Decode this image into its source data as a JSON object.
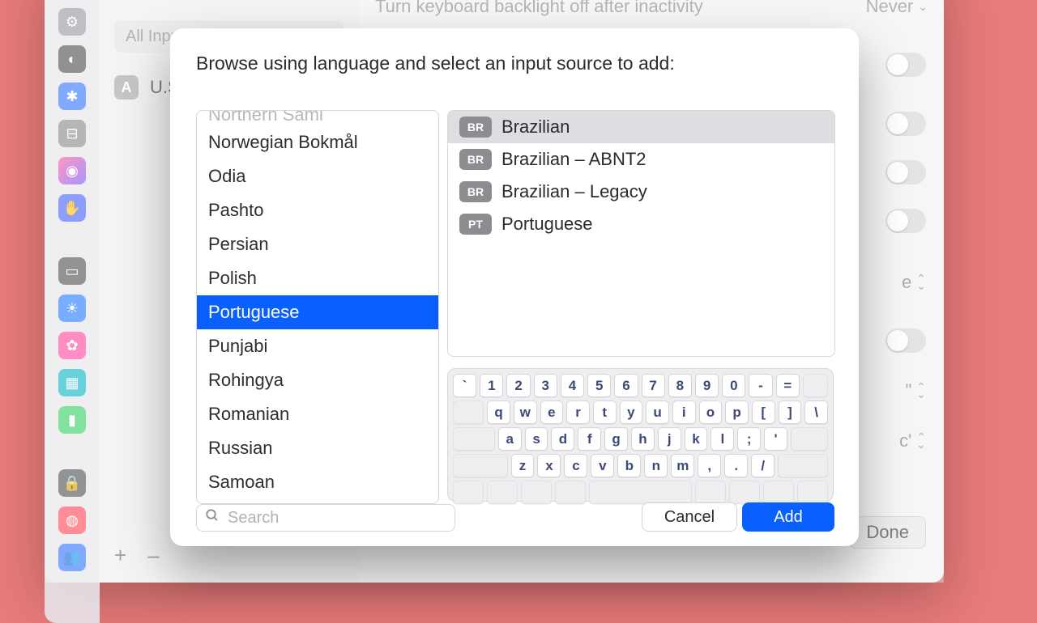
{
  "background": {
    "top_setting_label": "Turn keyboard backlight off after inactivity",
    "top_setting_value": "Never",
    "search_pill": "All Input",
    "us_item": "U.S.",
    "us_badge": "A",
    "right_value_e": "e",
    "right_value_quote": "\"",
    "right_value_c": "c'",
    "done": "Done",
    "plus": "+",
    "minus": "–"
  },
  "sheet": {
    "title": "Browse using language and select an input source to add:",
    "languages": [
      "Northern Sami",
      "Norwegian Bokmål",
      "Odia",
      "Pashto",
      "Persian",
      "Polish",
      "Portuguese",
      "Punjabi",
      "Rohingya",
      "Romanian",
      "Russian",
      "Samoan"
    ],
    "languages_selected_index": 6,
    "sources": [
      {
        "badge": "BR",
        "label": "Brazilian",
        "selected": true
      },
      {
        "badge": "BR",
        "label": "Brazilian – ABNT2",
        "selected": false
      },
      {
        "badge": "BR",
        "label": "Brazilian – Legacy",
        "selected": false
      },
      {
        "badge": "PT",
        "label": "Portuguese",
        "selected": false
      }
    ],
    "keyboard": {
      "row1": [
        "`",
        "1",
        "2",
        "3",
        "4",
        "5",
        "6",
        "7",
        "8",
        "9",
        "0",
        "-",
        "="
      ],
      "row2": [
        "q",
        "w",
        "e",
        "r",
        "t",
        "y",
        "u",
        "i",
        "o",
        "p",
        "[",
        "]",
        "\\"
      ],
      "row3": [
        "a",
        "s",
        "d",
        "f",
        "g",
        "h",
        "j",
        "k",
        "l",
        ";",
        "'"
      ],
      "row4": [
        "z",
        "x",
        "c",
        "v",
        "b",
        "n",
        "m",
        ",",
        ".",
        "/"
      ]
    },
    "search_placeholder": "Search",
    "cancel": "Cancel",
    "add": "Add"
  }
}
